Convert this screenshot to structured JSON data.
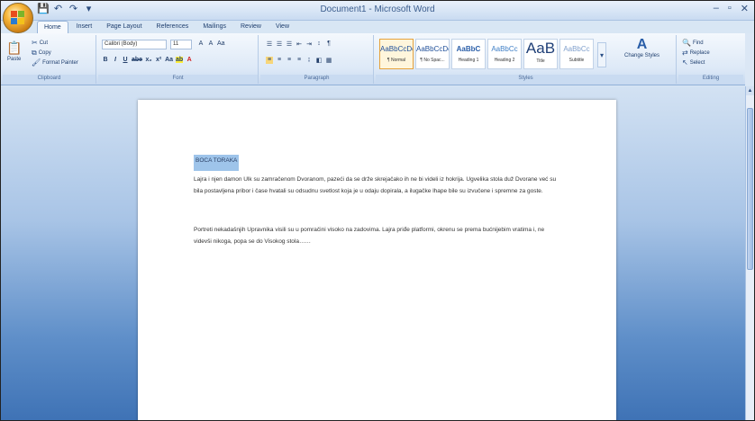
{
  "window": {
    "title": "Document1 - Microsoft Word",
    "controls": [
      "–",
      "▫",
      "✕"
    ]
  },
  "qat": {
    "save": "💾",
    "undo": "↶",
    "redo": "↷",
    "more": "▾"
  },
  "tabs": [
    "Home",
    "Insert",
    "Page Layout",
    "References",
    "Mailings",
    "Review",
    "View"
  ],
  "ribbon": {
    "clipboard": {
      "label": "Clipboard",
      "paste": "Paste",
      "cut": "Cut",
      "copy": "Copy",
      "format_painter": "Format Painter"
    },
    "font": {
      "label": "Font",
      "font_name": "Calibri (Body)",
      "font_size": "11",
      "row1": [
        "A",
        "A",
        "Aa"
      ],
      "row2": [
        "B",
        "I",
        "U",
        "abe",
        "x₂",
        "x²",
        "Aa",
        "ab",
        "A"
      ]
    },
    "paragraph": {
      "label": "Paragraph",
      "row1": [
        "☰",
        "☰",
        "☰",
        "⇤",
        "⇥",
        "↕",
        "¶"
      ],
      "row2": [
        "≡",
        "≡",
        "≡",
        "≡",
        "↨",
        "◧",
        "▦"
      ]
    },
    "styles": {
      "label": "Styles",
      "tiles": [
        {
          "sample": "AaBbCcDc",
          "name": "¶ Normal"
        },
        {
          "sample": "AaBbCcDc",
          "name": "¶ No Spac..."
        },
        {
          "sample": "AaBbC",
          "name": "Heading 1"
        },
        {
          "sample": "AaBbCc",
          "name": "Heading 2"
        },
        {
          "sample": "AaB",
          "name": "Title"
        },
        {
          "sample": "AaBbCc",
          "name": "Subtitle"
        }
      ],
      "change_styles": "Change Styles"
    },
    "editing": {
      "label": "Editing",
      "find": "Find",
      "replace": "Replace",
      "select": "Select"
    }
  },
  "document": {
    "title": "BOCA TORAKA",
    "paragraph1": "Lajra i njen damon Ulk su zamračenom Dvoranom, pazeći da se drže skrejačako ih ne bi videli iz hokrija. Ugvelika stola duž Dvorane već su bila postavljena pribor i čase hvatali su odsudnu svetlost koja je u odaju dopirala, a ilugačke lhape bile su izvučene i spremne za goste.",
    "paragraph2": "Portreti nekadašnjih Upravnika visili su u pomračini visoko na zadovima. Lajra priđe platformi, okrenu se prema bućnijebim vratima i, ne videvši nikoga, popa se do Visokog stola……"
  }
}
